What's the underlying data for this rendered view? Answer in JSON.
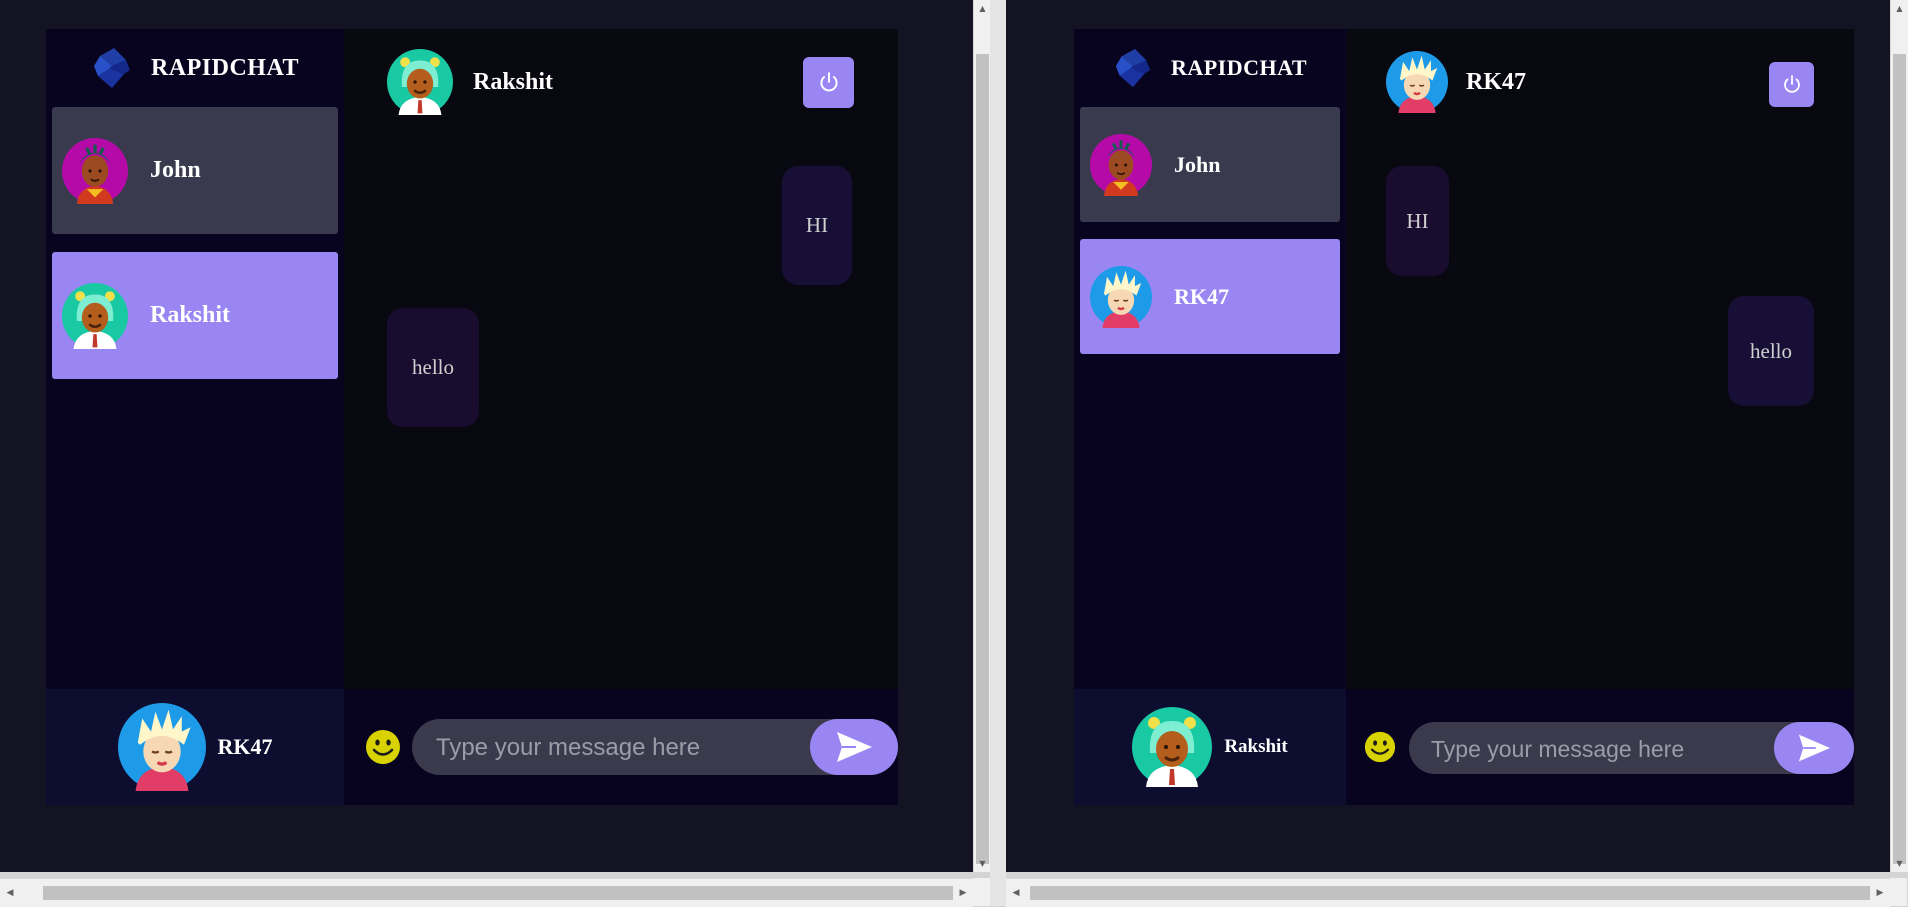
{
  "left": {
    "brand": "RAPIDCHAT",
    "contacts": [
      {
        "name": "John",
        "avatar": "girl-avatar-icon",
        "selected": false
      },
      {
        "name": "Rakshit",
        "avatar": "boy-green-hood-avatar-icon",
        "selected": true
      }
    ],
    "current_user": "RK47",
    "chat": {
      "title": "Rakshit",
      "messages": [
        {
          "text": "HI",
          "sent": true
        },
        {
          "text": "hello",
          "sent": false
        }
      ]
    },
    "input_placeholder": "Type your message here"
  },
  "right": {
    "brand": "RAPIDCHAT",
    "contacts": [
      {
        "name": "John",
        "avatar": "girl-avatar-icon",
        "selected": false
      },
      {
        "name": "RK47",
        "avatar": "blond-avatar-icon",
        "selected": true
      }
    ],
    "current_user": "Rakshit",
    "chat": {
      "title": "RK47",
      "messages": [
        {
          "text": "HI",
          "sent": false
        },
        {
          "text": "hello",
          "sent": true
        }
      ]
    },
    "input_placeholder": "Type your message here"
  },
  "colors": {
    "accent": "#9a86f3",
    "page_bg": "#131324",
    "sidebar_bg": "#080420",
    "chat_bg": "#080811",
    "contact_bg": "#3a3a4e"
  }
}
